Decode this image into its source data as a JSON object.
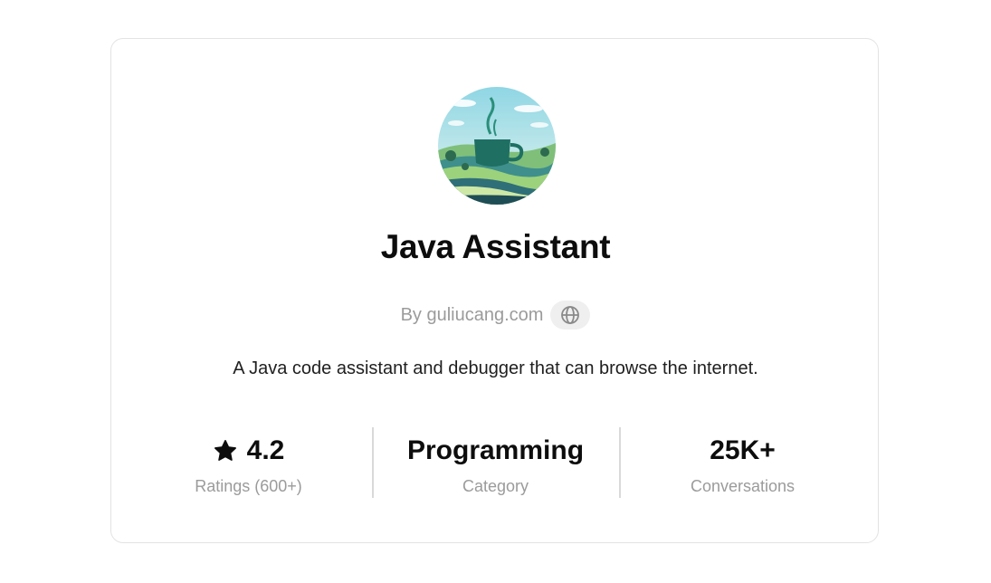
{
  "gpt": {
    "name": "Java Assistant",
    "author": "By guliucang.com",
    "description": "A Java code assistant and debugger that can browse the internet."
  },
  "icons": {
    "avatar": "coffee-cup-landscape",
    "website": "globe-icon",
    "rating": "star-icon"
  },
  "stats": [
    {
      "value": "4.2",
      "label": "Ratings (600+)"
    },
    {
      "value": "Programming",
      "label": "Category"
    },
    {
      "value": "25K+",
      "label": "Conversations"
    }
  ],
  "colors": {
    "title": "#0d0d0d",
    "muted": "#9b9b9b",
    "border": "#e3e3e3"
  }
}
